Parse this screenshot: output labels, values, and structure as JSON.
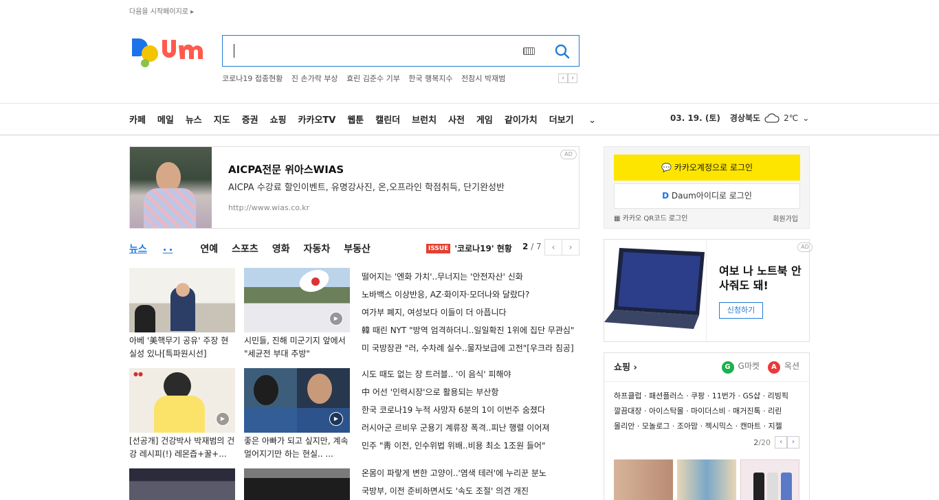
{
  "top": {
    "start_page_link": "다음을 시작페이지로"
  },
  "search": {
    "value": "",
    "suggestions": [
      "코로나19 접종현황",
      "진 손가락 부상",
      "효린 김준수 기부",
      "한국 행복지수",
      "전참시 박재범"
    ]
  },
  "gnb": {
    "items": [
      "카페",
      "메일",
      "뉴스",
      "지도",
      "증권",
      "쇼핑",
      "카카오TV",
      "웹툰",
      "캘린더",
      "브런치",
      "사전",
      "게임",
      "같이가치"
    ],
    "more": "더보기"
  },
  "weather": {
    "date": "03. 19. (토)",
    "region": "경상북도",
    "temp": "2℃"
  },
  "ad_main": {
    "title": "AICPA전문 위아스WIAS",
    "desc": "AICPA 수강료 할인이벤트, 유명강사진, 온,오프라인 학점취득, 단기완성반",
    "url": "http://www.wias.co.kr",
    "badge": "AD"
  },
  "news_tabs": {
    "items": [
      "뉴스",
      "연예",
      "스포츠",
      "영화",
      "자동차",
      "부동산"
    ],
    "active": 0
  },
  "issue": {
    "badge": "ISSUE",
    "text": "'코로나19' 현황",
    "page": "2",
    "total": "/ 7"
  },
  "news_cards": [
    {
      "caption": "아베 '美핵무기 공유' 주장 현실성 있나[특파원시선]"
    },
    {
      "caption": "시민들, 진해 미군기지 앞에서 \"세균전 부대 추방\""
    },
    {
      "caption": "[선공개] 건강박사 박재범의 건강 레시피(!) 레몬즙+꿀+..."
    },
    {
      "caption": "좋은 아빠가 되고 싶지만, 계속 멀어지기만 하는 현실.. ..."
    }
  ],
  "headlines": [
    "떨어지는 '엔화 가치'..무너지는 '안전자산' 신화",
    "노바백스 이상반응, AZ·화이자·모더나와 달랐다?",
    "여가부 폐지, 여성보다 이들이 더 아픕니다",
    "韓 때린 NYT \"방역 엄격하더니..일일확진 1위에 집단 무관심\"",
    "미 국방장관 \"러, 수차례 실수..물자보급에 고전\"[우크라 침공]",
    "시도 때도 없는 장 트러블.. '이 음식' 피해야",
    "中 어선 '인력시장'으로 활용되는 부산항",
    "한국 코로나19 누적 사망자 6분의 1이 이번주 숨졌다",
    "러시아군 르비우 군용기 계류장 폭격..피난 행렬 이어져",
    "민주 \"靑 이전, 인수위법 위배..비용 최소 1조원 들어\"",
    "온몸이 파랗게 변한 고양이..'염색 테러'에 누리꾼 분노",
    "국방부, 이전 준비하면서도 '속도 조절' 의견 개진"
  ],
  "login": {
    "kakao": "카카오계정으로 로그인",
    "daum": "Daum아이디로 로그인",
    "qr": "카카오 QR코드 로그인",
    "join": "회원가입"
  },
  "ad_side": {
    "title": "여보 나 노트북 안 사줘도 돼!",
    "button": "신청하기",
    "badge": "AD"
  },
  "shopping": {
    "title": "쇼핑",
    "gmarket": "G마켓",
    "auction": "옥션",
    "links": [
      "하프클럽 · 패션플러스 · 쿠팡 · 11번가 · GS샵 · 리빙픽",
      "깔끔대장 · 아이스탁몰 · 마이더스비 · 매거진톡 · 리린",
      "몰리안 · 모놀로그 · 조아맘 · 젝시믹스 · 캔마트 · 지젤"
    ],
    "page": "2",
    "total": "/20"
  }
}
